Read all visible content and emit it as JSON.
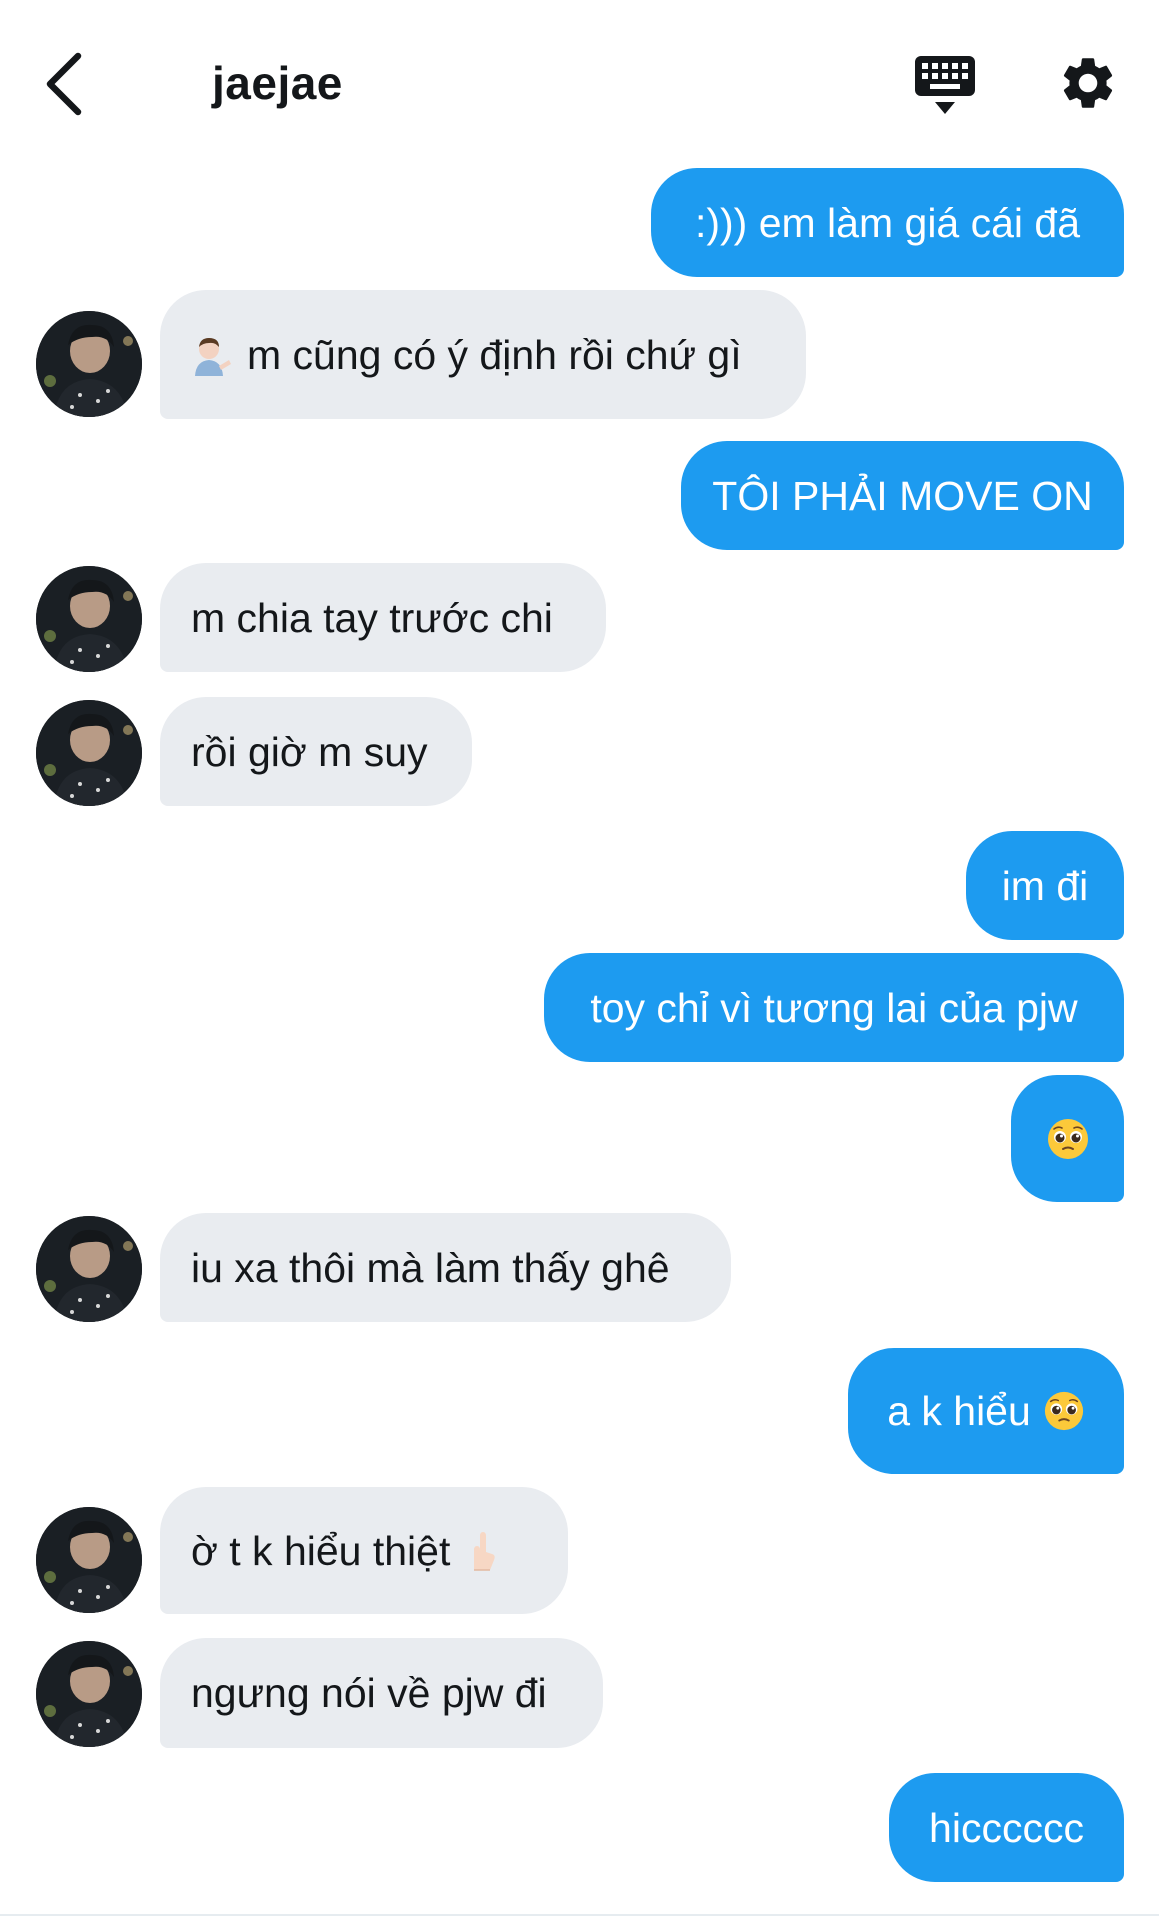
{
  "header": {
    "title": "jaejae",
    "back_icon": "chevron-left-icon",
    "keyboard_icon": "keyboard-hide-icon",
    "settings_icon": "gear-icon"
  },
  "colors": {
    "outgoing_bubble": "#1d9bf0",
    "incoming_bubble": "#e9ecf0",
    "text_dark": "#14171a",
    "text_light": "#ffffff"
  },
  "messages": [
    {
      "direction": "outgoing",
      "text": ":))) em làm giá cái đã"
    },
    {
      "direction": "incoming",
      "emoji": "man-tipping-hand-emoji",
      "text": "m cũng có ý định rồi chứ gì"
    },
    {
      "direction": "outgoing",
      "text": "TÔI PHẢI MOVE ON"
    },
    {
      "direction": "incoming",
      "text": "m chia tay trước chi"
    },
    {
      "direction": "incoming",
      "text": "rồi giờ m suy"
    },
    {
      "direction": "outgoing",
      "text": "im đi"
    },
    {
      "direction": "outgoing",
      "text": "toy chỉ vì tương lai của pjw"
    },
    {
      "direction": "outgoing",
      "emoji": "pleading-face-emoji",
      "text": ""
    },
    {
      "direction": "incoming",
      "text": "iu xa thôi mà làm thấy ghê"
    },
    {
      "direction": "outgoing",
      "text": "a k hiểu",
      "emoji": "pleading-face-emoji"
    },
    {
      "direction": "incoming",
      "text": "ờ t k hiểu thiệt",
      "emoji": "raised-back-of-hand-emoji"
    },
    {
      "direction": "incoming",
      "text": "ngưng nói về pjw đi"
    },
    {
      "direction": "outgoing",
      "text": "hicccccc"
    }
  ]
}
